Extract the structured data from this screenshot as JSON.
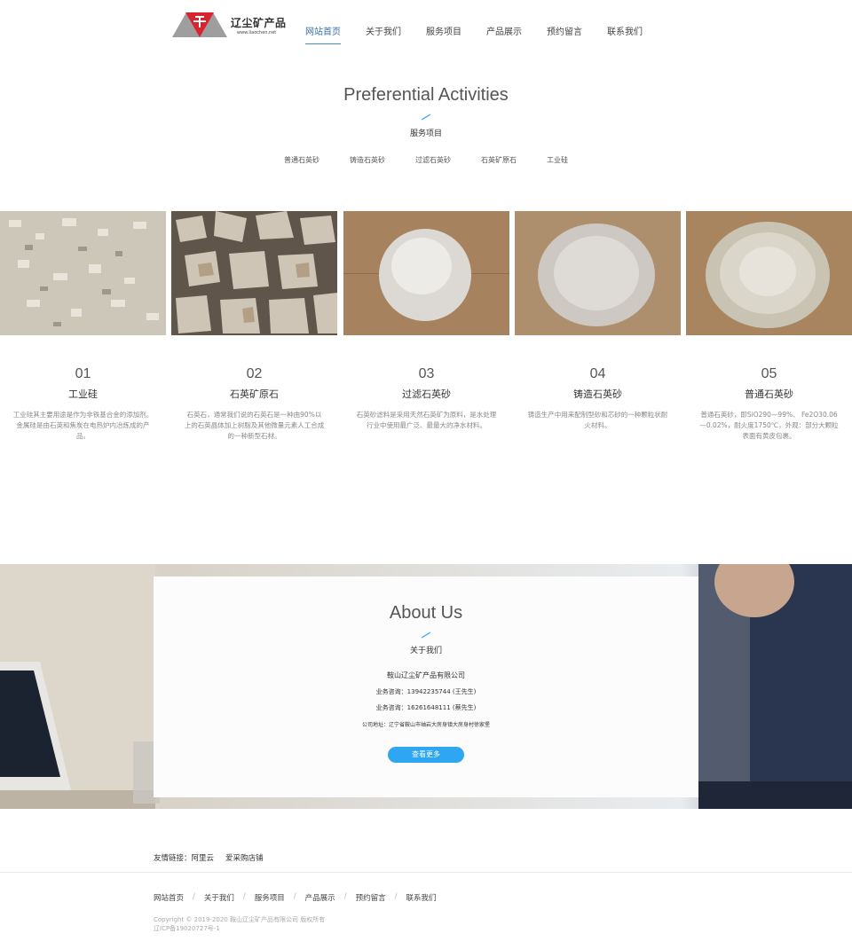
{
  "header": {
    "logo_text": "辽尘矿产品",
    "logo_sub": "www.liaochen.net",
    "nav": [
      "网站首页",
      "关于我们",
      "服务项目",
      "产品展示",
      "预约留言",
      "联系我们"
    ],
    "active_index": 0
  },
  "services": {
    "title": "Preferential Activities",
    "subtitle": "服务项目",
    "tabs": [
      "普通石英砂",
      "铸造石英砂",
      "过滤石英砂",
      "石英矿原石",
      "工业硅"
    ],
    "products": [
      {
        "num": "01",
        "name": "工业硅",
        "desc": "工业硅其主要用途是作为非铁基合金的添加剂。金属硅是由石英和焦炭在电热炉内冶炼成的产品。"
      },
      {
        "num": "02",
        "name": "石英矿原石",
        "desc": "石英石，通常我们说的石英石是一种由90%以上的石英晶体加上树脂及其他微量元素人工合成的一种新型石材。"
      },
      {
        "num": "03",
        "name": "过滤石英砂",
        "desc": "石英砂滤料是采用天然石英矿为原料，是水处理行业中使用最广泛、最最大的净水材料。"
      },
      {
        "num": "04",
        "name": "铸造石英砂",
        "desc": "铸造生产中用来配制型砂和芯砂的一种颗粒状耐火材料。"
      },
      {
        "num": "05",
        "name": "普通石英砂",
        "desc": "普通石英砂，即SiO290—99%、 Fe2O30.06—0.02%，耐火度1750℃，外观：部分大颗粒表面有黄皮包裹。"
      }
    ]
  },
  "about": {
    "title": "About Us",
    "subtitle": "关于我们",
    "company": "鞍山辽尘矿产品有限公司",
    "phone1": "业务咨询：13942235744 (王先生)",
    "phone2": "业务咨询：16261648111 (蔡先生)",
    "address": "公司地址：辽宁省鞍山市岫岩大房身镇大房身村徐家堡",
    "button": "查看更多"
  },
  "footer": {
    "links_label": "友情链接：",
    "links": [
      "阿里云",
      "爱采购店铺"
    ],
    "nav": [
      "网站首页",
      "关于我们",
      "服务项目",
      "产品展示",
      "预约留言",
      "联系我们"
    ],
    "copyright": "Copyright © 2019-2020 鞍山辽尘矿产品有限公司 版权所有",
    "icp": "辽ICP备19020727号-1"
  },
  "colors": {
    "accent": "#2fa6f2",
    "nav_active": "#3d6ea6",
    "logo_red": "#d9232e",
    "logo_gray": "#9e9e9e"
  }
}
